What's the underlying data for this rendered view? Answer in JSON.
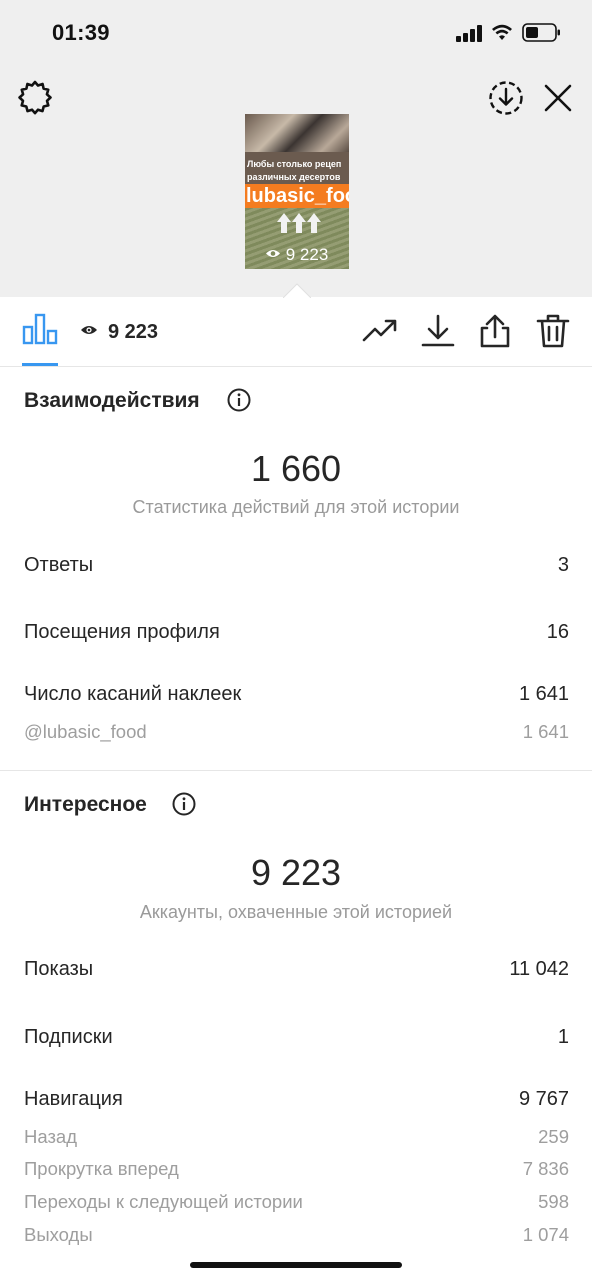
{
  "status_bar": {
    "time": "01:39"
  },
  "story_preview": {
    "caption_line1": "Любы столько рецеп",
    "caption_line2": "различных десертов",
    "handle_text": "lubasic_food",
    "views": "9 223"
  },
  "toolbar": {
    "views": "9 223",
    "accent_color": "#3897f0",
    "icons": [
      "bar-chart-icon",
      "eye-icon",
      "trending-icon",
      "download-icon",
      "share-icon",
      "trash-icon"
    ]
  },
  "interactions": {
    "title": "Взаимодействия",
    "total": "1 660",
    "caption": "Статистика действий для этой истории",
    "rows": [
      {
        "label": "Ответы",
        "value": "3"
      },
      {
        "label": "Посещения профиля",
        "value": "16"
      },
      {
        "label": "Число касаний наклеек",
        "value": "1 641"
      }
    ],
    "sub_rows": [
      {
        "label": "@lubasic_food",
        "value": "1 641"
      }
    ]
  },
  "discovery": {
    "title": "Интересное",
    "total": "9 223",
    "caption": "Аккаунты, охваченные этой историей",
    "rows": [
      {
        "label": "Показы",
        "value": "11 042"
      },
      {
        "label": "Подписки",
        "value": "1"
      },
      {
        "label": "Навигация",
        "value": "9 767"
      }
    ],
    "sub_rows": [
      {
        "label": "Назад",
        "value": "259"
      },
      {
        "label": "Прокрутка вперед",
        "value": "7 836"
      },
      {
        "label": "Переходы к следующей истории",
        "value": "598"
      },
      {
        "label": "Выходы",
        "value": "1 074"
      }
    ]
  }
}
